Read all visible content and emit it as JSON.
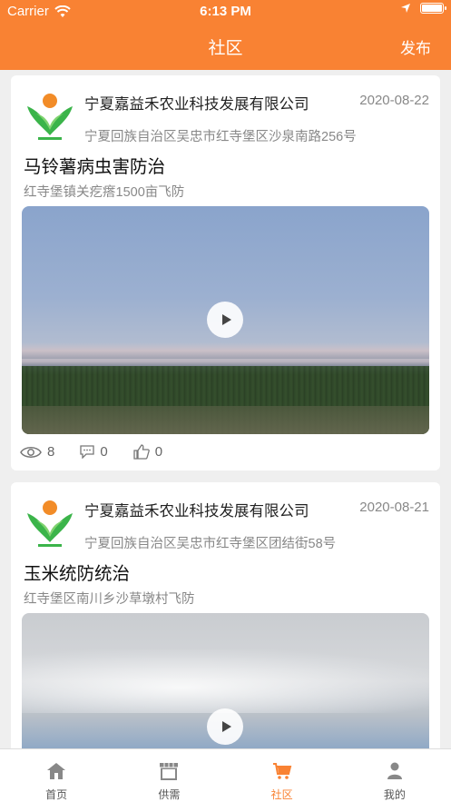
{
  "status_bar": {
    "carrier": "Carrier",
    "time": "6:13 PM"
  },
  "header": {
    "title": "社区",
    "action_label": "发布"
  },
  "posts": [
    {
      "company": "宁夏嘉益禾农业科技发展有限公司",
      "date": "2020-08-22",
      "address": "宁夏回族自治区吴忠市红寺堡区沙泉南路256号",
      "title": "马铃薯病虫害防治",
      "subtitle": "红寺堡镇关疙瘩1500亩飞防",
      "views": "8",
      "comments": "0",
      "likes": "0"
    },
    {
      "company": "宁夏嘉益禾农业科技发展有限公司",
      "date": "2020-08-21",
      "address": "宁夏回族自治区吴忠市红寺堡区团结街58号",
      "title": "玉米统防统治",
      "subtitle": "红寺堡区南川乡沙草墩村飞防"
    }
  ],
  "tabbar": {
    "items": [
      {
        "label": "首页",
        "icon": "home-icon"
      },
      {
        "label": "供需",
        "icon": "store-icon"
      },
      {
        "label": "社区",
        "icon": "cart-icon"
      },
      {
        "label": "我的",
        "icon": "user-icon"
      }
    ]
  },
  "colors": {
    "accent": "#f98233",
    "background": "#efefef"
  }
}
